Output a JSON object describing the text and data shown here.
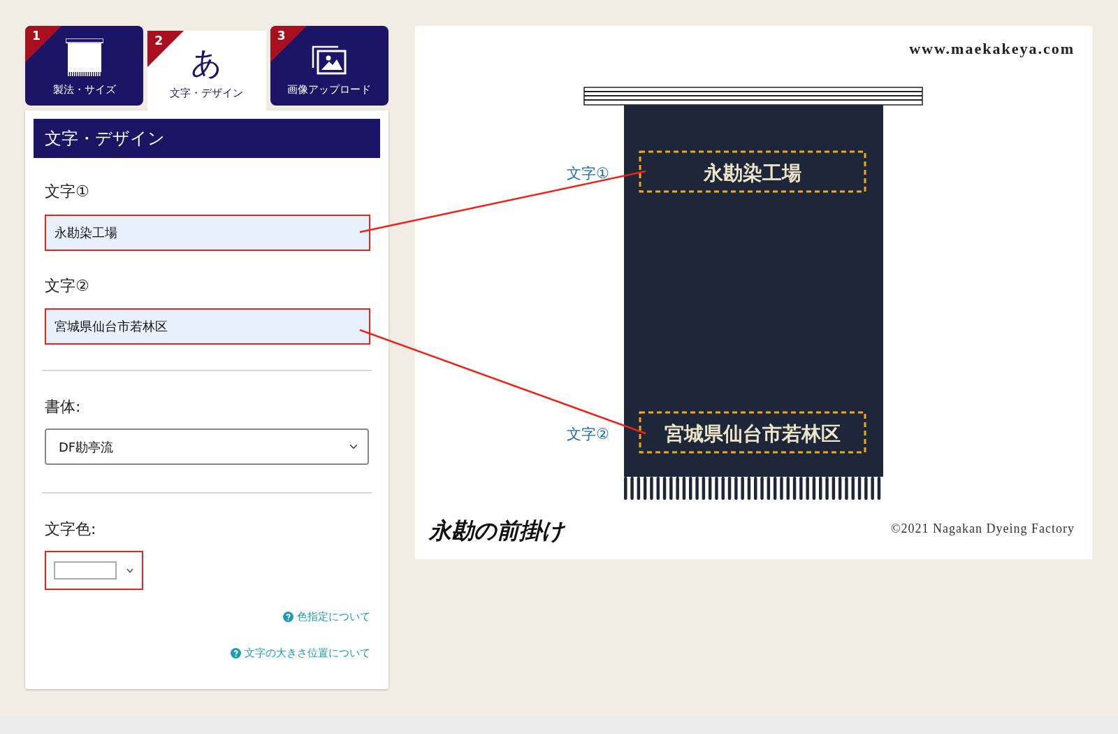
{
  "tabs": [
    {
      "number": "1",
      "kind": "curtain",
      "label": "製法・サイズ",
      "selected": false
    },
    {
      "number": "2",
      "kind": "glyph",
      "glyph": "あ",
      "label": "文字・デザイン",
      "selected": true
    },
    {
      "number": "3",
      "kind": "image",
      "label": "画像アップロード",
      "selected": false
    }
  ],
  "panel": {
    "title": "文字・デザイン",
    "fields": [
      {
        "label": "文字①",
        "value": "永勘染工場",
        "highlighted": true
      },
      {
        "label": "文字②",
        "value": "宮城県仙台市若林区",
        "highlighted": true
      }
    ],
    "font": {
      "label": "書体:",
      "value": "DF勘亭流"
    },
    "text_color": {
      "label": "文字色:",
      "highlighted": true
    },
    "links": [
      "色指定について",
      "文字の大きさ位置について"
    ]
  },
  "preview": {
    "site": "www.maekakeya.com",
    "markers": [
      "文字①",
      "文字②"
    ],
    "texts": [
      "永勘染工場",
      "宮城県仙台市若林区"
    ],
    "logo": "永勘の前掛け",
    "copyright": "©2021 Nagakan Dyeing Factory"
  }
}
